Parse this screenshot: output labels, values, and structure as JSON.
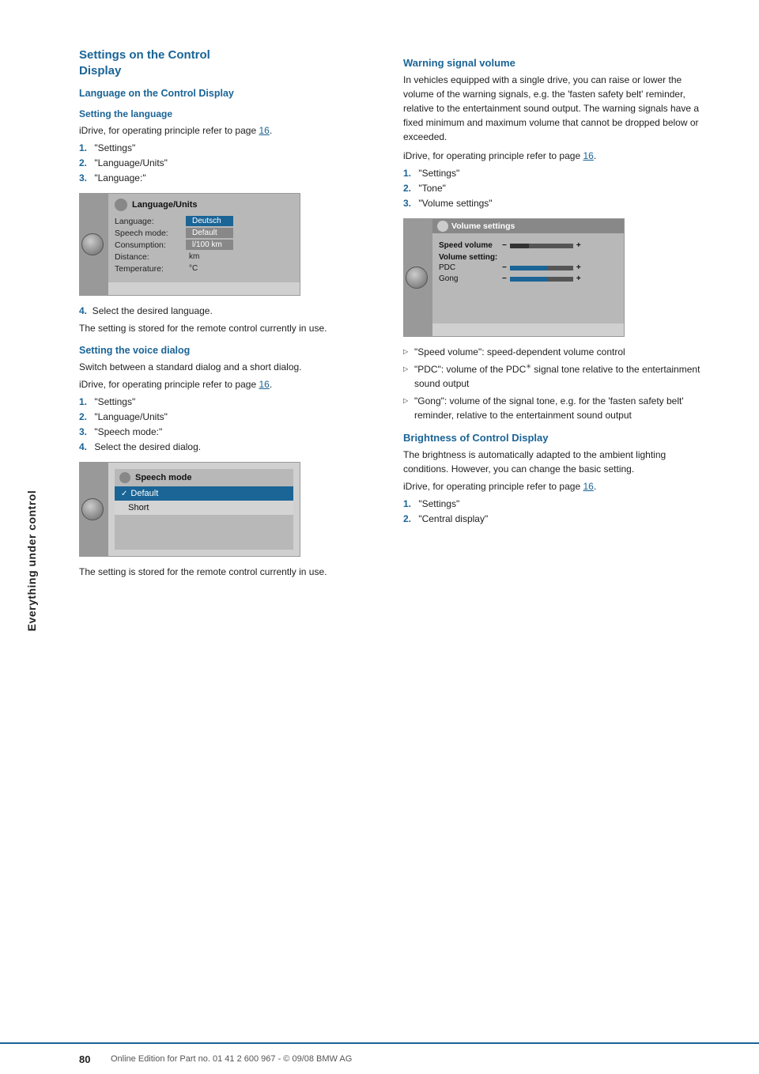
{
  "sidebar": {
    "label": "Everything under control"
  },
  "left_column": {
    "section_title_line1": "Settings on the Control",
    "section_title_line2": "Display",
    "subsection1": {
      "title": "Language on the Control Display",
      "setting_language": {
        "title": "Setting the language",
        "intro": "iDrive, for operating principle refer to page",
        "page_ref": "16",
        "intro_end": ".",
        "steps": [
          {
            "num": "1.",
            "text": "\"Settings\""
          },
          {
            "num": "2.",
            "text": "\"Language/Units\""
          },
          {
            "num": "3.",
            "text": "\"Language:\""
          }
        ],
        "screenshot": {
          "title": "Language/Units",
          "rows": [
            {
              "label": "Language:",
              "value": "Deutsch",
              "style": "blue"
            },
            {
              "label": "Speech mode:",
              "value": "Default",
              "style": "gray"
            },
            {
              "label": "Consumption:",
              "value": "l/100 km",
              "style": "gray"
            },
            {
              "label": "Distance:",
              "value": "km",
              "style": "plain"
            },
            {
              "label": "Temperature:",
              "value": "°C",
              "style": "plain"
            }
          ]
        },
        "step4": "4. Select the desired language.",
        "note": "The setting is stored for the remote control currently in use."
      },
      "setting_voice": {
        "title": "Setting the voice dialog",
        "intro_text": "Switch between a standard dialog and a short dialog.",
        "idrive_text": "iDrive, for operating principle refer to page",
        "page_ref": "16",
        "idrive_end": ".",
        "steps": [
          {
            "num": "1.",
            "text": "\"Settings\""
          },
          {
            "num": "2.",
            "text": "\"Language/Units\""
          },
          {
            "num": "3.",
            "text": "\"Speech mode:\""
          },
          {
            "num": "4.",
            "text": "Select the desired dialog."
          }
        ],
        "screenshot": {
          "title": "Speech mode",
          "rows": [
            {
              "text": "Default",
              "selected": true
            },
            {
              "text": "Short",
              "selected": false
            }
          ]
        },
        "note": "The setting is stored for the remote control currently in use."
      }
    }
  },
  "right_column": {
    "warning_signal": {
      "title": "Warning signal volume",
      "body1": "In vehicles equipped with a single drive, you can raise or lower the volume of the warning signals, e.g. the 'fasten safety belt' reminder, relative to the entertainment sound output. The warning signals have a fixed minimum and maximum volume that cannot be dropped below or exceeded.",
      "idrive_text": "iDrive, for operating principle refer to page",
      "page_ref": "16",
      "idrive_end": ".",
      "steps": [
        {
          "num": "1.",
          "text": "\"Settings\""
        },
        {
          "num": "2.",
          "text": "\"Tone\""
        },
        {
          "num": "3.",
          "text": "\"Volume settings\""
        }
      ],
      "screenshot": {
        "title": "Volume settings",
        "speed_volume": "Speed volume",
        "volume_setting": "Volume setting:",
        "rows": [
          {
            "label": "PDC",
            "has_bar": true
          },
          {
            "label": "Gong",
            "has_bar": true
          }
        ]
      },
      "bullets": [
        "\"Speed volume\": speed-dependent volume control",
        "\"PDC\": volume of the PDC∗ signal tone relative to the entertainment sound output",
        "\"Gong\": volume of the signal tone, e.g. for the 'fasten safety belt' reminder, relative to the entertainment sound output"
      ]
    },
    "brightness": {
      "title": "Brightness of Control Display",
      "body1": "The brightness is automatically adapted to the ambient lighting conditions. However, you can change the basic setting.",
      "idrive_text": "iDrive, for operating principle refer to page",
      "page_ref": "16",
      "idrive_end": ".",
      "steps": [
        {
          "num": "1.",
          "text": "\"Settings\""
        },
        {
          "num": "2.",
          "text": "\"Central display\""
        }
      ]
    }
  },
  "footer": {
    "page_number": "80",
    "text": "Online Edition for Part no. 01 41 2 600 967  - © 09/08 BMW AG"
  }
}
